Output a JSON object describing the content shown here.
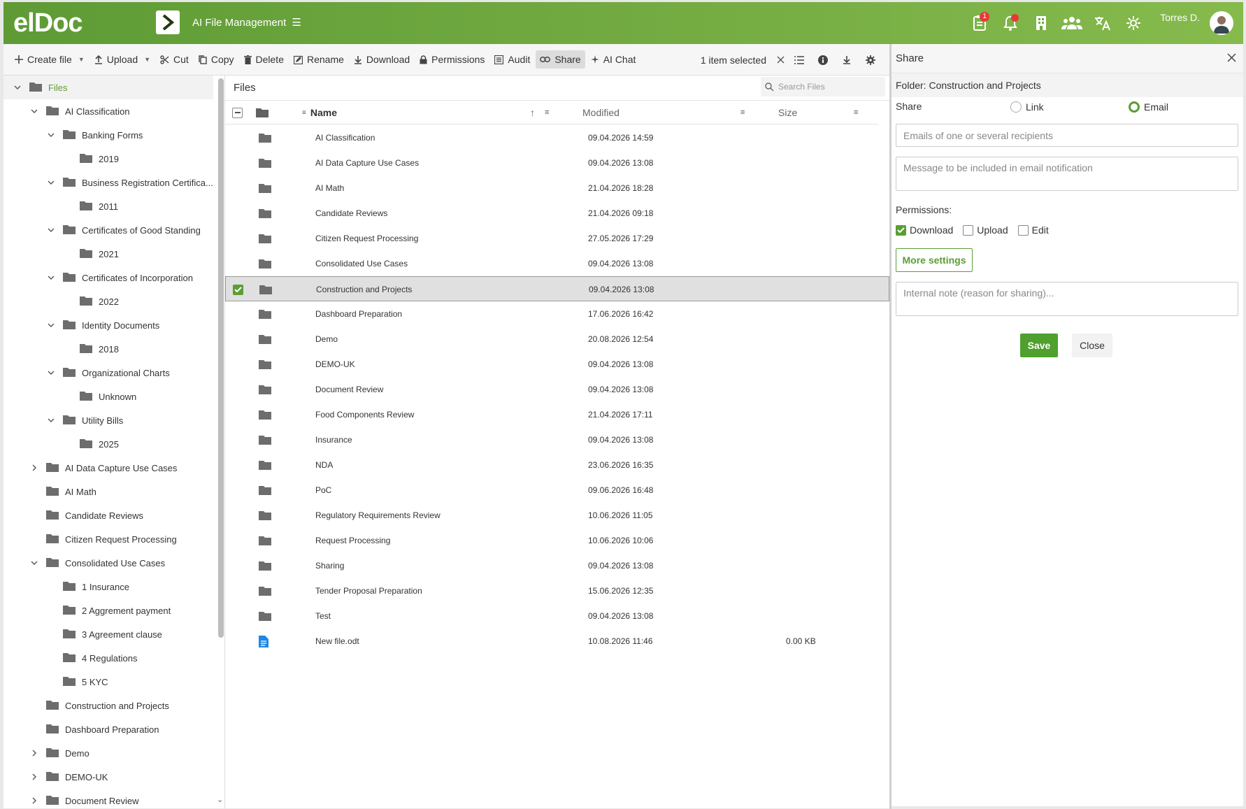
{
  "app": {
    "logo": "elDoc",
    "title": "AI File Management",
    "user": "Torres D.",
    "notification_count": "1"
  },
  "toolbar": {
    "create_file": "Create file",
    "upload": "Upload",
    "cut": "Cut",
    "copy": "Copy",
    "delete": "Delete",
    "rename": "Rename",
    "download": "Download",
    "permissions": "Permissions",
    "audit": "Audit",
    "share": "Share",
    "ai_chat": "AI Chat",
    "selection": "1 item selected"
  },
  "tree": {
    "nodes": [
      {
        "label": "Files",
        "level": 0,
        "expander": "open"
      },
      {
        "label": "AI Classification",
        "level": 1,
        "expander": "open"
      },
      {
        "label": "Banking Forms",
        "level": 2,
        "expander": "open"
      },
      {
        "label": "2019",
        "level": 3,
        "expander": "none"
      },
      {
        "label": "Business Registration Certifica...",
        "level": 2,
        "expander": "open"
      },
      {
        "label": "2011",
        "level": 3,
        "expander": "none"
      },
      {
        "label": "Certificates of Good Standing",
        "level": 2,
        "expander": "open"
      },
      {
        "label": "2021",
        "level": 3,
        "expander": "none"
      },
      {
        "label": "Certificates of Incorporation",
        "level": 2,
        "expander": "open"
      },
      {
        "label": "2022",
        "level": 3,
        "expander": "none"
      },
      {
        "label": "Identity Documents",
        "level": 2,
        "expander": "open"
      },
      {
        "label": "2018",
        "level": 3,
        "expander": "none"
      },
      {
        "label": "Organizational Charts",
        "level": 2,
        "expander": "open"
      },
      {
        "label": "Unknown",
        "level": 3,
        "expander": "none"
      },
      {
        "label": "Utility Bills",
        "level": 2,
        "expander": "open"
      },
      {
        "label": "2025",
        "level": 3,
        "expander": "none"
      },
      {
        "label": "AI Data Capture Use Cases",
        "level": 1,
        "expander": "closed"
      },
      {
        "label": "AI Math",
        "level": 1,
        "expander": "none"
      },
      {
        "label": "Candidate Reviews",
        "level": 1,
        "expander": "none"
      },
      {
        "label": "Citizen Request Processing",
        "level": 1,
        "expander": "none"
      },
      {
        "label": "Consolidated Use Cases",
        "level": 1,
        "expander": "open"
      },
      {
        "label": "1 Insurance",
        "level": 2,
        "expander": "none"
      },
      {
        "label": "2 Aggrement payment",
        "level": 2,
        "expander": "none"
      },
      {
        "label": "3 Agreement clause",
        "level": 2,
        "expander": "none"
      },
      {
        "label": "4 Regulations",
        "level": 2,
        "expander": "none"
      },
      {
        "label": "5 KYC",
        "level": 2,
        "expander": "none"
      },
      {
        "label": "Construction and Projects",
        "level": 1,
        "expander": "none"
      },
      {
        "label": "Dashboard Preparation",
        "level": 1,
        "expander": "none"
      },
      {
        "label": "Demo",
        "level": 1,
        "expander": "closed"
      },
      {
        "label": "DEMO-UK",
        "level": 1,
        "expander": "closed"
      },
      {
        "label": "Document Review",
        "level": 1,
        "expander": "closed"
      }
    ]
  },
  "files": {
    "title": "Files",
    "search_placeholder": "Search Files",
    "columns": {
      "name": "Name",
      "modified": "Modified",
      "size": "Size"
    },
    "rows": [
      {
        "name": "AI Classification",
        "modified": "09.04.2026 14:59",
        "size": "",
        "type": "folder",
        "selected": false
      },
      {
        "name": "AI Data Capture Use Cases",
        "modified": "09.04.2026 13:08",
        "size": "",
        "type": "folder",
        "selected": false
      },
      {
        "name": "AI Math",
        "modified": "21.04.2026 18:28",
        "size": "",
        "type": "folder",
        "selected": false
      },
      {
        "name": "Candidate Reviews",
        "modified": "21.04.2026 09:18",
        "size": "",
        "type": "folder",
        "selected": false
      },
      {
        "name": "Citizen Request Processing",
        "modified": "27.05.2026 17:29",
        "size": "",
        "type": "folder",
        "selected": false
      },
      {
        "name": "Consolidated Use Cases",
        "modified": "09.04.2026 13:08",
        "size": "",
        "type": "folder",
        "selected": false
      },
      {
        "name": "Construction and Projects",
        "modified": "09.04.2026 13:08",
        "size": "",
        "type": "folder",
        "selected": true
      },
      {
        "name": "Dashboard Preparation",
        "modified": "17.06.2026 16:42",
        "size": "",
        "type": "folder",
        "selected": false
      },
      {
        "name": "Demo",
        "modified": "20.08.2026 12:54",
        "size": "",
        "type": "folder",
        "selected": false
      },
      {
        "name": "DEMO-UK",
        "modified": "09.04.2026 13:08",
        "size": "",
        "type": "folder",
        "selected": false
      },
      {
        "name": "Document Review",
        "modified": "09.04.2026 13:08",
        "size": "",
        "type": "folder",
        "selected": false
      },
      {
        "name": "Food Components Review",
        "modified": "21.04.2026 17:11",
        "size": "",
        "type": "folder",
        "selected": false
      },
      {
        "name": "Insurance",
        "modified": "09.04.2026 13:08",
        "size": "",
        "type": "folder",
        "selected": false
      },
      {
        "name": "NDA",
        "modified": "23.06.2026 16:35",
        "size": "",
        "type": "folder",
        "selected": false
      },
      {
        "name": "PoC",
        "modified": "09.06.2026 16:48",
        "size": "",
        "type": "folder",
        "selected": false
      },
      {
        "name": "Regulatory Requirements Review",
        "modified": "10.06.2026 11:05",
        "size": "",
        "type": "folder",
        "selected": false
      },
      {
        "name": "Request Processing",
        "modified": "10.06.2026 10:06",
        "size": "",
        "type": "folder",
        "selected": false
      },
      {
        "name": "Sharing",
        "modified": "09.04.2026 13:08",
        "size": "",
        "type": "folder",
        "selected": false
      },
      {
        "name": "Tender Proposal Preparation",
        "modified": "15.06.2026 12:35",
        "size": "",
        "type": "folder",
        "selected": false
      },
      {
        "name": "Test",
        "modified": "09.04.2026 13:08",
        "size": "",
        "type": "folder",
        "selected": false
      },
      {
        "name": "New file.odt",
        "modified": "10.08.2026 11:46",
        "size": "0.00 KB",
        "type": "document",
        "selected": false
      }
    ]
  },
  "share_panel": {
    "title": "Share",
    "folder": "Folder: Construction and Projects",
    "share_label": "Share",
    "option_link": "Link",
    "option_email": "Email",
    "selected_option": "Email",
    "emails_placeholder": "Emails of one or several recipients",
    "message_placeholder": "Message to be included in email notification",
    "permissions_label": "Permissions:",
    "perm_download": "Download",
    "perm_upload": "Upload",
    "perm_edit": "Edit",
    "perm_download_checked": true,
    "perm_upload_checked": false,
    "perm_edit_checked": false,
    "more_settings": "More settings",
    "note_placeholder": "Internal note (reason for sharing)...",
    "save": "Save",
    "close": "Close"
  },
  "colors": {
    "brand_green": "#5e9b35",
    "accent_green": "#4fa02d",
    "badge_red": "#e53935",
    "doc_blue": "#1e88e5"
  }
}
